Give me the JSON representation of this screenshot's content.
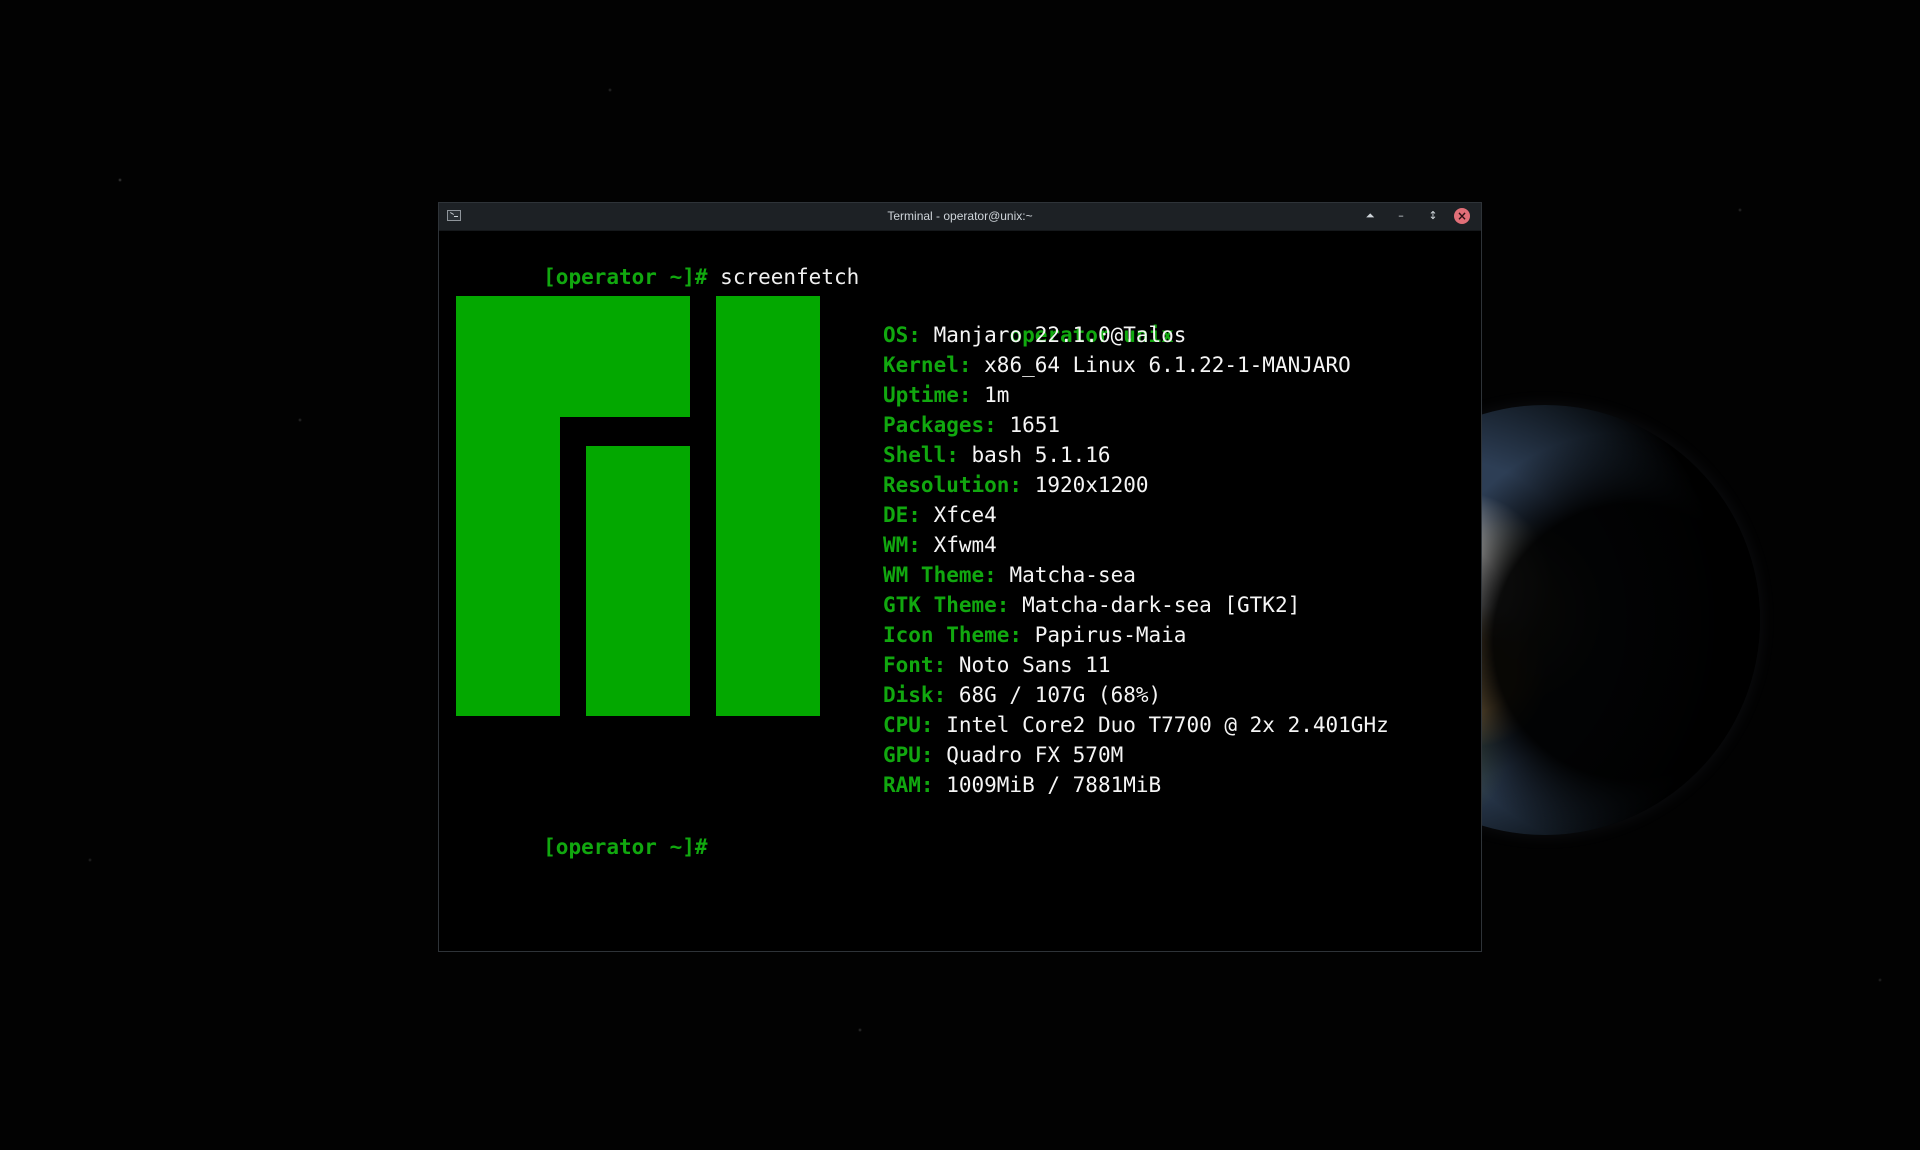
{
  "window": {
    "title": "Terminal - operator@unix:~",
    "icon": "terminal-icon",
    "controls": {
      "up_icon": "shade-icon",
      "minimize_icon": "minimize-icon",
      "maximize_icon": "maximize-icon",
      "close_icon": "close-icon"
    }
  },
  "terminal": {
    "first_prompt": "[operator ~]#",
    "first_command": " screenfetch",
    "second_prompt": "[operator ~]#",
    "info": {
      "user": "operator",
      "at": "@",
      "host": "unix",
      "rows": [
        {
          "key": "OS:",
          "value": " Manjaro 22.1.0 Talos"
        },
        {
          "key": "Kernel:",
          "value": " x86_64 Linux 6.1.22-1-MANJARO"
        },
        {
          "key": "Uptime:",
          "value": " 1m"
        },
        {
          "key": "Packages:",
          "value": " 1651"
        },
        {
          "key": "Shell:",
          "value": " bash 5.1.16"
        },
        {
          "key": "Resolution:",
          "value": " 1920x1200"
        },
        {
          "key": "DE:",
          "value": " Xfce4"
        },
        {
          "key": "WM:",
          "value": " Xfwm4"
        },
        {
          "key": "WM Theme:",
          "value": " Matcha-sea"
        },
        {
          "key": "GTK Theme:",
          "value": " Matcha-dark-sea [GTK2]"
        },
        {
          "key": "Icon Theme:",
          "value": " Papirus-Maia"
        },
        {
          "key": "Font:",
          "value": " Noto Sans 11"
        },
        {
          "key": "Disk:",
          "value": " 68G / 107G (68%)"
        },
        {
          "key": "CPU:",
          "value": " Intel Core2 Duo T7700 @ 2x 2.401GHz"
        },
        {
          "key": "GPU:",
          "value": " Quadro FX 570M"
        },
        {
          "key": "RAM:",
          "value": " 1009MiB / 7881MiB"
        }
      ]
    }
  },
  "colors": {
    "terminal_background": "#000000",
    "green": "#11a80f",
    "logo_green": "#03a800",
    "foreground": "#f5f5f5",
    "close_button": "#e16f78"
  }
}
